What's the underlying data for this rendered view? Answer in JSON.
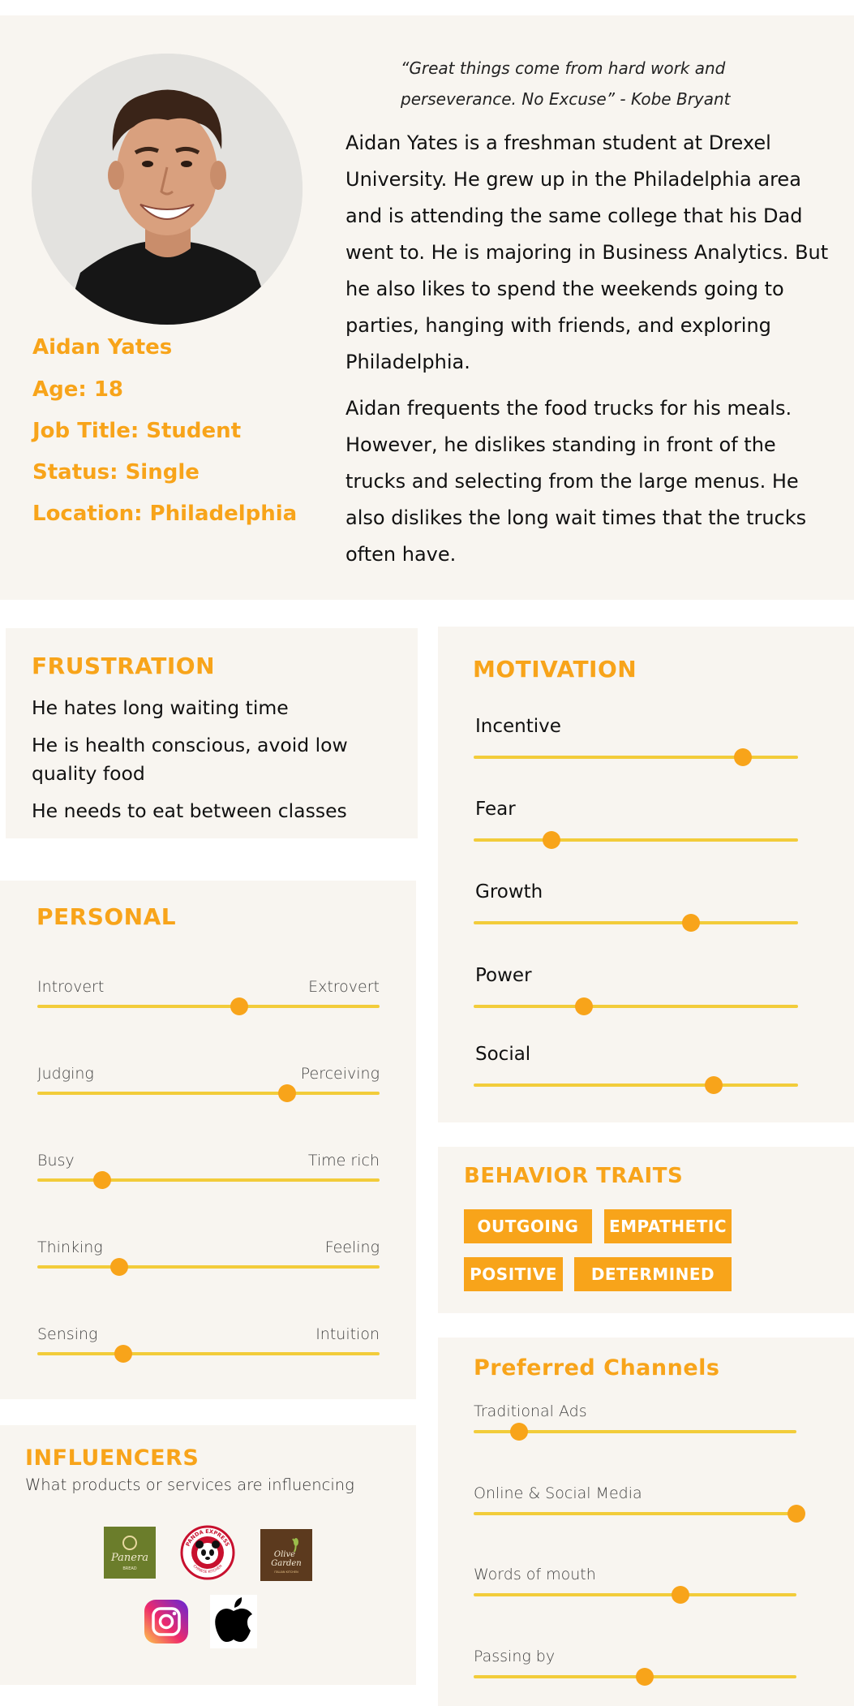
{
  "profile": {
    "quote": "“Great things come from hard work and perseverance. No Excuse” - Kobe Bryant",
    "name": "Aidan Yates",
    "age": "Age: 18",
    "job": "Job Title: Student",
    "status": "Status: Single",
    "location": "Location: Philadelphia",
    "bio_1": "Aidan Yates is a freshman student at Drexel University. He grew up in the Philadelphia area and is attending the same college that his Dad went to. He is majoring in Business Analytics. But he also likes to spend the weekends going to parties, hanging with friends, and  exploring Philadelphia.",
    "bio_2": "Aidan frequents the food trucks for his meals. However, he dislikes standing in front of the trucks and selecting from the large menus. He also dislikes the long wait times that the trucks often have."
  },
  "frustration": {
    "title": "FRUSTRATION",
    "items": [
      "He hates long waiting time",
      "He is  health conscious, avoid low quality food",
      "He needs to eat between classes"
    ]
  },
  "motivation": {
    "title": "MOTIVATION",
    "items": [
      {
        "label": "Incentive",
        "level": 0.83
      },
      {
        "label": "Fear",
        "level": 0.24
      },
      {
        "label": "Growth",
        "level": 0.67
      },
      {
        "label": "Power",
        "level": 0.34
      },
      {
        "label": "Social",
        "level": 0.74
      }
    ]
  },
  "personal": {
    "title": "PERSONAL",
    "items": [
      {
        "left": "Introvert",
        "right": "Extrovert",
        "level": 0.59
      },
      {
        "left": "Judging",
        "right": "Perceiving",
        "level": 0.73
      },
      {
        "left": "Busy",
        "right": "Time rich",
        "level": 0.19
      },
      {
        "left": "Thinking",
        "right": "Feeling",
        "level": 0.24
      },
      {
        "left": "Sensing",
        "right": "Intuition",
        "level": 0.25
      }
    ]
  },
  "behavior": {
    "title": "BEHAVIOR TRAITS",
    "traits": [
      "OUTGOING",
      "EMPATHETIC",
      "POSITIVE",
      "DETERMINED"
    ]
  },
  "channels": {
    "title": "Preferred Channels",
    "items": [
      {
        "label": "Traditional Ads",
        "level": 0.14
      },
      {
        "label": "Online & Social Media",
        "level": 1.0
      },
      {
        "label": "Words of mouth",
        "level": 0.64
      },
      {
        "label": "Passing by",
        "level": 0.53
      }
    ]
  },
  "influencers": {
    "title": "INFLUENCERS",
    "subtitle": "What products or services are influencing",
    "logos": [
      {
        "icon": "panera-logo",
        "text": "Panera",
        "subtext": "BREAD"
      },
      {
        "icon": "panda-express-logo",
        "text": "PANDA EXPRESS",
        "subtext": "CHINESE KITCHEN"
      },
      {
        "icon": "olive-garden-logo",
        "text": "Olive Garden",
        "subtext": "ITALIAN KITCHEN"
      },
      {
        "icon": "instagram-icon"
      },
      {
        "icon": "apple-icon"
      }
    ]
  },
  "colors": {
    "accent": "#f8a41a",
    "track": "#f2cc3a",
    "card": "#f8f5f0"
  }
}
